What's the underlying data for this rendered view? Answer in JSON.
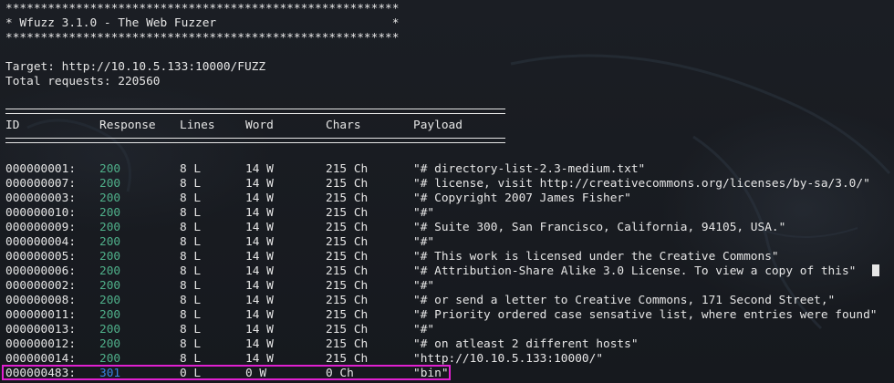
{
  "banner": {
    "stars": "********************************************************",
    "title_line": "* Wfuzz 3.1.0 - The Web Fuzzer                         *"
  },
  "target_line": "Target: http://10.10.5.133:10000/FUZZ",
  "total_line": "Total requests: 220560",
  "headers": {
    "id": "ID",
    "response": "Response",
    "lines": "Lines",
    "word": "Word",
    "chars": "Chars",
    "payload": "Payload"
  },
  "rows": [
    {
      "id": "000000001:",
      "response": "200",
      "lines": "8 L",
      "word": "14 W",
      "chars": "215 Ch",
      "payload": "\"# directory-list-2.3-medium.txt\""
    },
    {
      "id": "000000007:",
      "response": "200",
      "lines": "8 L",
      "word": "14 W",
      "chars": "215 Ch",
      "payload": "\"# license, visit http://creativecommons.org/licenses/by-sa/3.0/\""
    },
    {
      "id": "000000003:",
      "response": "200",
      "lines": "8 L",
      "word": "14 W",
      "chars": "215 Ch",
      "payload": "\"# Copyright 2007 James Fisher\""
    },
    {
      "id": "000000010:",
      "response": "200",
      "lines": "8 L",
      "word": "14 W",
      "chars": "215 Ch",
      "payload": "\"#\""
    },
    {
      "id": "000000009:",
      "response": "200",
      "lines": "8 L",
      "word": "14 W",
      "chars": "215 Ch",
      "payload": "\"# Suite 300, San Francisco, California, 94105, USA.\""
    },
    {
      "id": "000000004:",
      "response": "200",
      "lines": "8 L",
      "word": "14 W",
      "chars": "215 Ch",
      "payload": "\"#\""
    },
    {
      "id": "000000005:",
      "response": "200",
      "lines": "8 L",
      "word": "14 W",
      "chars": "215 Ch",
      "payload": "\"# This work is licensed under the Creative Commons\""
    },
    {
      "id": "000000006:",
      "response": "200",
      "lines": "8 L",
      "word": "14 W",
      "chars": "215 Ch",
      "payload": "\"# Attribution-Share Alike 3.0 License. To view a copy of this\""
    },
    {
      "id": "000000002:",
      "response": "200",
      "lines": "8 L",
      "word": "14 W",
      "chars": "215 Ch",
      "payload": "\"#\""
    },
    {
      "id": "000000008:",
      "response": "200",
      "lines": "8 L",
      "word": "14 W",
      "chars": "215 Ch",
      "payload": "\"# or send a letter to Creative Commons, 171 Second Street,\""
    },
    {
      "id": "000000011:",
      "response": "200",
      "lines": "8 L",
      "word": "14 W",
      "chars": "215 Ch",
      "payload": "\"# Priority ordered case sensative list, where entries were found\""
    },
    {
      "id": "000000013:",
      "response": "200",
      "lines": "8 L",
      "word": "14 W",
      "chars": "215 Ch",
      "payload": "\"#\""
    },
    {
      "id": "000000012:",
      "response": "200",
      "lines": "8 L",
      "word": "14 W",
      "chars": "215 Ch",
      "payload": "\"# on atleast 2 different hosts\""
    },
    {
      "id": "000000014:",
      "response": "200",
      "lines": "8 L",
      "word": "14 W",
      "chars": "215 Ch",
      "payload": "\"http://10.10.5.133:10000/\""
    },
    {
      "id": "000000483:",
      "response": "301",
      "lines": "0 L",
      "word": "0 W",
      "chars": "0 Ch",
      "payload": "\"bin\""
    }
  ],
  "colors": {
    "code_200": "#4fb08a",
    "code_301": "#3a84e0",
    "highlight": "#e020d0",
    "text": "#e6e6e6",
    "background": "#1a1d22"
  }
}
